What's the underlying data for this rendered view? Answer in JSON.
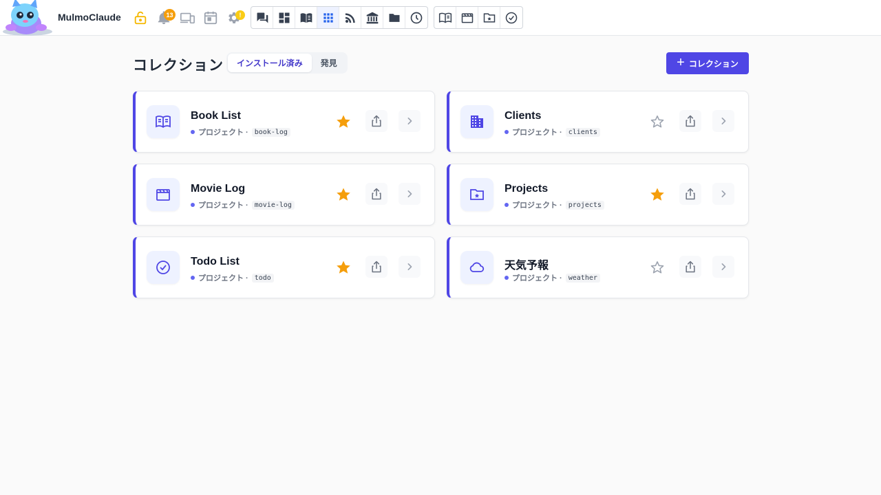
{
  "app": {
    "title": "MulmoClaude"
  },
  "topbar": {
    "notifications_count": "13",
    "settings_badge": "!"
  },
  "page": {
    "title": "コレクション",
    "tabs": [
      {
        "label": "インストール済み",
        "active": true
      },
      {
        "label": "発見",
        "active": false
      }
    ],
    "new_button_label": "コレクション"
  },
  "cards": [
    {
      "title": "Book List",
      "kind": "プロジェクト ·",
      "slug": "book-log",
      "icon": "book-icon",
      "starred": true
    },
    {
      "title": "Clients",
      "kind": "プロジェクト ·",
      "slug": "clients",
      "icon": "building-icon",
      "starred": false
    },
    {
      "title": "Movie Log",
      "kind": "プロジェクト ·",
      "slug": "movie-log",
      "icon": "film-icon",
      "starred": true
    },
    {
      "title": "Projects",
      "kind": "プロジェクト ·",
      "slug": "projects",
      "icon": "folder-star-icon",
      "starred": true
    },
    {
      "title": "Todo List",
      "kind": "プロジェクト ·",
      "slug": "todo",
      "icon": "check-circle-icon",
      "starred": true
    },
    {
      "title": "天気予報",
      "kind": "プロジェクト ·",
      "slug": "weather",
      "icon": "cloud-icon",
      "starred": false
    }
  ],
  "colors": {
    "accent": "#4f46e5",
    "star_filled": "#f59e0b",
    "star_empty": "#9ca3af",
    "lock": "#f5b800"
  }
}
